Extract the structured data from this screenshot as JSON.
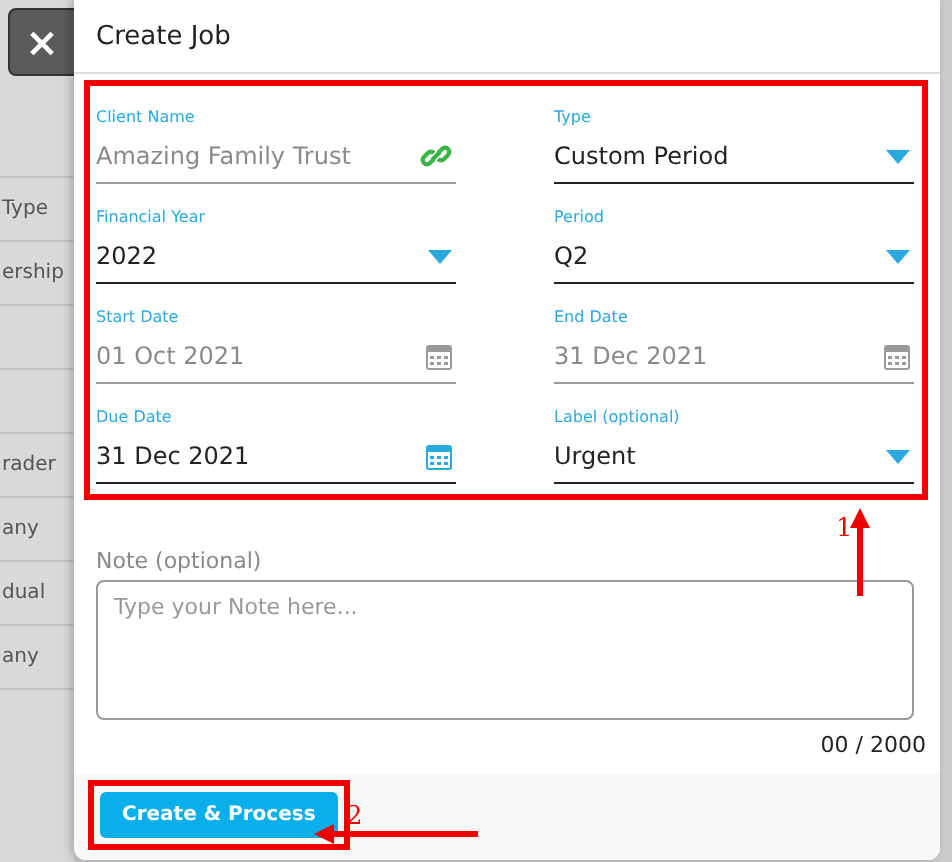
{
  "background": {
    "rows": [
      "Type",
      "ership",
      "",
      "",
      "rader",
      "any",
      "dual",
      "any"
    ]
  },
  "dialog": {
    "close_button": "×",
    "title": "Create Job",
    "fields": [
      {
        "label": "Client Name",
        "value": "Amazing Family Trust",
        "kind": "link",
        "disabled": true
      },
      {
        "label": "Type",
        "value": "Custom Period",
        "kind": "dropdown",
        "disabled": false
      },
      {
        "label": "Financial Year",
        "value": "2022",
        "kind": "dropdown",
        "disabled": false
      },
      {
        "label": "Period",
        "value": "Q2",
        "kind": "dropdown",
        "disabled": false
      },
      {
        "label": "Start Date",
        "value": "01 Oct 2021",
        "kind": "date",
        "disabled": true
      },
      {
        "label": "End Date",
        "value": "31 Dec 2021",
        "kind": "date",
        "disabled": true
      },
      {
        "label": "Due Date",
        "value": "31 Dec 2021",
        "kind": "date",
        "disabled": false
      },
      {
        "label": "Label (optional)",
        "value": "Urgent",
        "kind": "dropdown",
        "disabled": false
      }
    ],
    "note": {
      "label": "Note (optional)",
      "placeholder": "Type your Note here...",
      "counter": "00 / 2000"
    },
    "buttons": [
      "Create & Process"
    ]
  },
  "annotations": [
    {
      "label": "1"
    },
    {
      "label": "2"
    }
  ]
}
